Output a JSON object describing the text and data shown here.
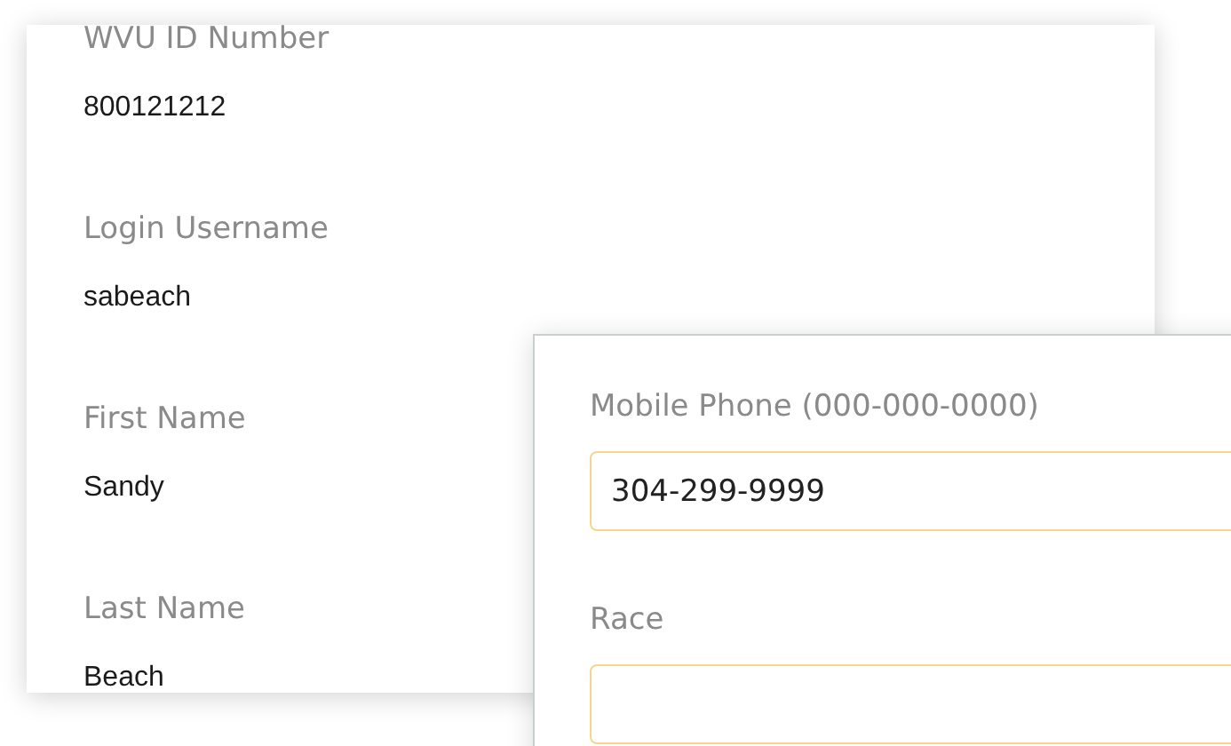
{
  "profile": {
    "fields": [
      {
        "label": "WVU ID Number",
        "value": "800121212"
      },
      {
        "label": "Login Username",
        "value": "sabeach"
      },
      {
        "label": "First Name",
        "value": "Sandy"
      },
      {
        "label": "Last Name",
        "value": "Beach"
      }
    ]
  },
  "contact_form": {
    "fields": [
      {
        "label": "Mobile Phone (000-000-0000)",
        "value": "304-299-9999"
      },
      {
        "label": "Race"
      }
    ]
  }
}
